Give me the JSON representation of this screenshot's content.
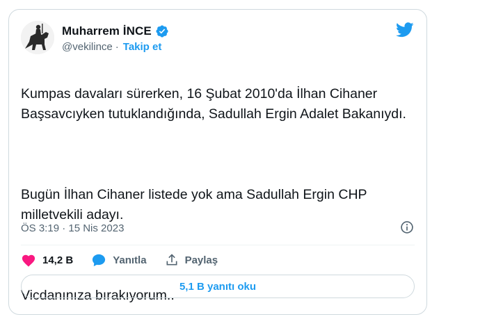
{
  "author": {
    "name": "Muharrem İNCE",
    "handle": "@vekilince",
    "follow_label": "Takip et",
    "separator": "·",
    "verified_icon": "verified-badge-icon",
    "verified_color": "#1d9bf0"
  },
  "brand": {
    "icon": "twitter-bird-icon",
    "color": "#1d9bf0"
  },
  "tweet": {
    "paragraph_1": "Kumpas davaları sürerken, 16 Şubat 2010'da İlhan Cihaner Başsavcıyken tutuklandığında, Sadullah Ergin Adalet Bakanıydı.",
    "paragraph_2": "Bugün İlhan Cihaner listede yok ama Sadullah Ergin CHP milletvekili adayı.",
    "paragraph_3": "Vicdanınıza bırakıyorum..",
    "timestamp": "ÖS 3:19 · 15 Nis 2023"
  },
  "actions": {
    "like_count": "14,2 B",
    "like_color": "#f91880",
    "reply_label": "Yanıtla",
    "share_label": "Paylaş"
  },
  "footer": {
    "replies_button": "5,1 B yanıtı oku"
  }
}
